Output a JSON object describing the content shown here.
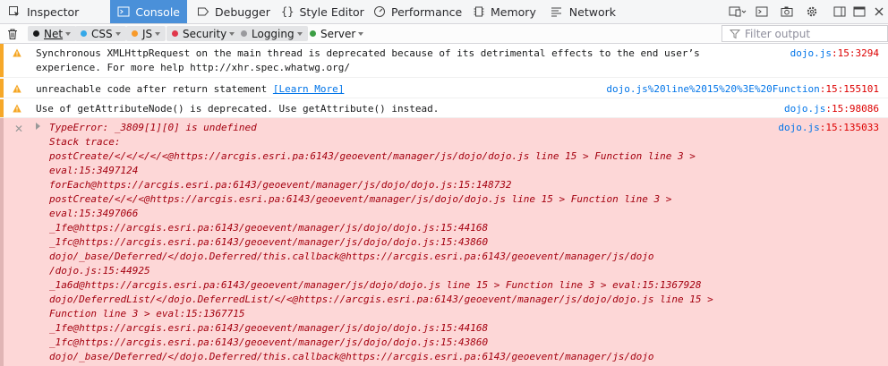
{
  "tabs": [
    {
      "label": "Inspector",
      "icon": "inspector-icon",
      "selected": false
    },
    {
      "label": "Console",
      "icon": "console-icon",
      "selected": true
    },
    {
      "label": "Debugger",
      "icon": "debugger-icon",
      "selected": false
    },
    {
      "label": "Style Editor",
      "icon": "style-editor-icon",
      "selected": false
    },
    {
      "label": "Performance",
      "icon": "performance-icon",
      "selected": false
    },
    {
      "label": "Memory",
      "icon": "memory-icon",
      "selected": false
    },
    {
      "label": "Network",
      "icon": "network-icon",
      "selected": false
    }
  ],
  "filters": [
    {
      "label": "Net",
      "color": "#18191a",
      "on": true
    },
    {
      "label": "CSS",
      "color": "#35a8e8",
      "on": true
    },
    {
      "label": "JS",
      "color": "#f79a2b",
      "on": true
    },
    {
      "label": "Security",
      "color": "#e0374b",
      "on": true
    },
    {
      "label": "Logging",
      "color": "#9a9a9e",
      "on": true
    },
    {
      "label": "Server",
      "color": "#3c9e44",
      "on": false
    }
  ],
  "filter_input": {
    "placeholder": "Filter output",
    "value": ""
  },
  "messages": {
    "m1": {
      "text1": "Synchronous XMLHttpRequest on the main thread is deprecated because of its detrimental effects to the end user’s",
      "text2": "experience. For more help http://xhr.spec.whatwg.org/",
      "file": "dojo.js",
      "line": ":15:3294"
    },
    "m2": {
      "text": "unreachable code after return statement ",
      "link": "[Learn More]",
      "file": "dojo.js%20line%2015%20%3E%20Function",
      "line": ":15:155101"
    },
    "m3": {
      "text": "Use of getAttributeNode() is deprecated. Use getAttribute() instead.",
      "file": "dojo.js",
      "line": ":15:98086"
    },
    "err": {
      "file": "dojo.js",
      "line": ":15:135033",
      "lines": [
        "TypeError: _3809[1][0] is undefined",
        "Stack trace:",
        "postCreate/</</</</<@https://arcgis.esri.pa:6143/geoevent/manager/js/dojo/dojo.js line 15 > Function line 3 >",
        "eval:15:3497124",
        "forEach@https://arcgis.esri.pa:6143/geoevent/manager/js/dojo/dojo.js:15:148732",
        "postCreate/</</<@https://arcgis.esri.pa:6143/geoevent/manager/js/dojo/dojo.js line 15 > Function line 3 >",
        "eval:15:3497066",
        "_1fe@https://arcgis.esri.pa:6143/geoevent/manager/js/dojo/dojo.js:15:44168",
        "_1fc@https://arcgis.esri.pa:6143/geoevent/manager/js/dojo/dojo.js:15:43860",
        "dojo/_base/Deferred/</dojo.Deferred/this.callback@https://arcgis.esri.pa:6143/geoevent/manager/js/dojo",
        "/dojo.js:15:44925",
        "_1a6d@https://arcgis.esri.pa:6143/geoevent/manager/js/dojo/dojo.js line 15 > Function line 3 > eval:15:1367928",
        "dojo/DeferredList/</dojo.DeferredList/</<@https://arcgis.esri.pa:6143/geoevent/manager/js/dojo/dojo.js line 15 >",
        "Function line 3 > eval:15:1367715",
        "_1fe@https://arcgis.esri.pa:6143/geoevent/manager/js/dojo/dojo.js:15:44168",
        "_1fc@https://arcgis.esri.pa:6143/geoevent/manager/js/dojo/dojo.js:15:43860",
        "dojo/_base/Deferred/</dojo.Deferred/this.callback@https://arcgis.esri.pa:6143/geoevent/manager/js/dojo"
      ]
    }
  }
}
